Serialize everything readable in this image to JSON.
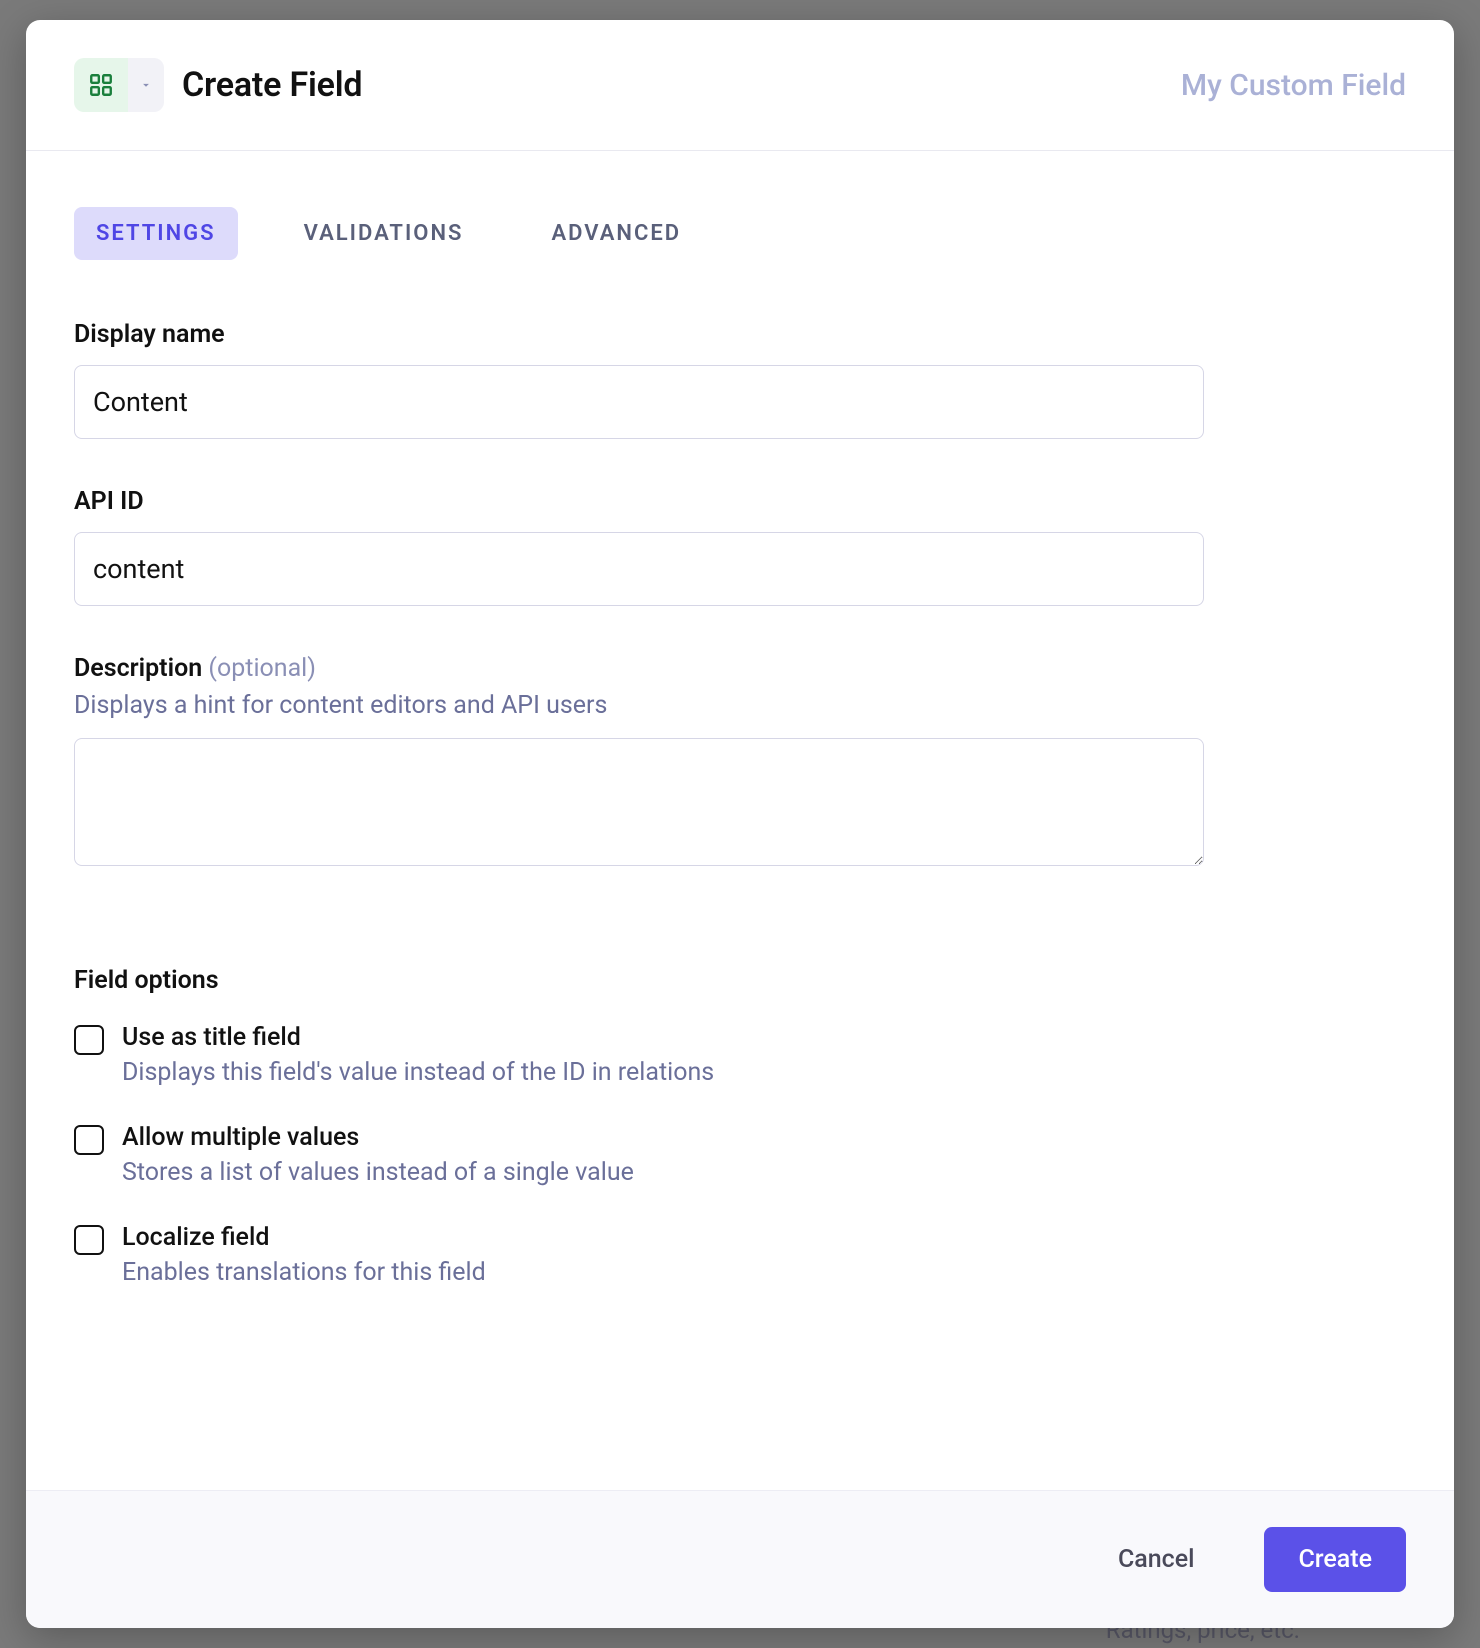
{
  "header": {
    "title": "Create Field",
    "subtitle": "My Custom Field",
    "icon_name": "grid-icon"
  },
  "tabs": [
    {
      "label": "SETTINGS",
      "active": true
    },
    {
      "label": "VALIDATIONS",
      "active": false
    },
    {
      "label": "ADVANCED",
      "active": false
    }
  ],
  "form": {
    "display_name": {
      "label": "Display name",
      "value": "Content"
    },
    "api_id": {
      "label": "API ID",
      "value": "content"
    },
    "description": {
      "label": "Description",
      "optional_suffix": "(optional)",
      "hint": "Displays a hint for content editors and API users",
      "value": ""
    }
  },
  "field_options": {
    "title": "Field options",
    "items": [
      {
        "label": "Use as title field",
        "desc": "Displays this field's value instead of the ID in relations",
        "checked": false
      },
      {
        "label": "Allow multiple values",
        "desc": "Stores a list of values instead of a single value",
        "checked": false
      },
      {
        "label": "Localize field",
        "desc": "Enables translations for this field",
        "checked": false
      }
    ]
  },
  "footer": {
    "cancel": "Cancel",
    "create": "Create"
  },
  "background_hint": "Ratings, price, etc."
}
